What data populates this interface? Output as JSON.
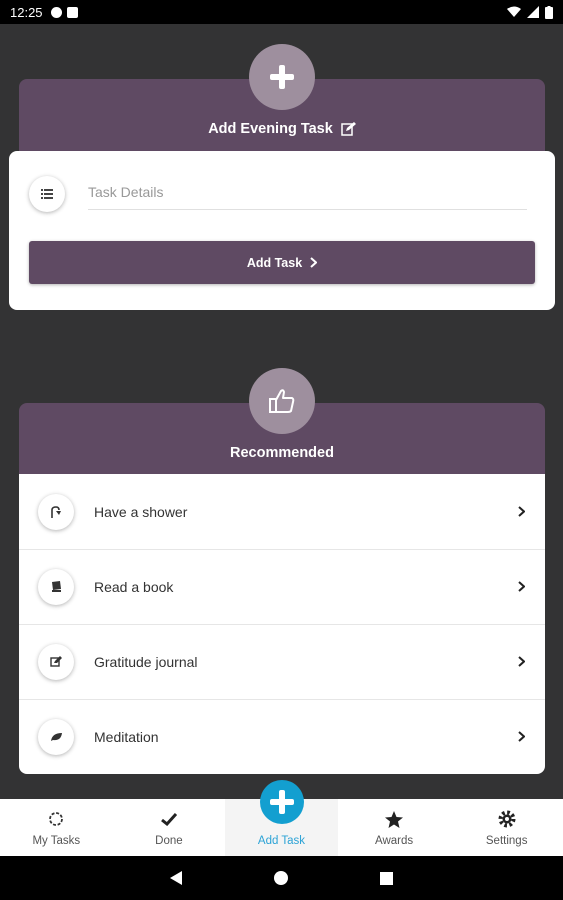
{
  "status_bar": {
    "time": "12:25"
  },
  "add_card": {
    "title": "Add Evening Task",
    "input_placeholder": "Task Details",
    "button_label": "Add Task"
  },
  "recommended": {
    "title": "Recommended",
    "items": [
      {
        "label": "Have a shower",
        "icon": "shower-icon"
      },
      {
        "label": "Read a book",
        "icon": "book-icon"
      },
      {
        "label": "Gratitude journal",
        "icon": "journal-icon"
      },
      {
        "label": "Meditation",
        "icon": "leaf-icon"
      }
    ]
  },
  "bottom_nav": {
    "items": [
      {
        "label": "My Tasks",
        "icon": "sun-icon"
      },
      {
        "label": "Done",
        "icon": "check-icon"
      },
      {
        "label": "Add Task",
        "icon": "plus-icon",
        "active": true
      },
      {
        "label": "Awards",
        "icon": "star-icon"
      },
      {
        "label": "Settings",
        "icon": "gear-icon"
      }
    ]
  },
  "colors": {
    "background": "#333334",
    "header_purple": "#5f4a63",
    "badge": "#9e8f9e",
    "accent_blue": "#139fd0"
  }
}
